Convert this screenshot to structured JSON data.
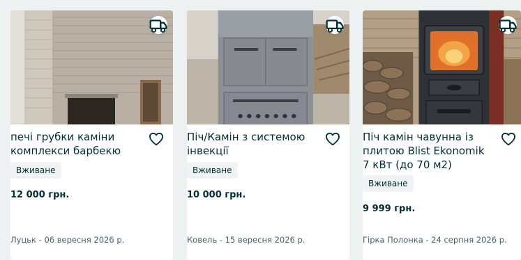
{
  "listings": [
    {
      "title": "печі грубки каміни комплекси барбекю",
      "condition": "Вживане",
      "price": "12 000 грн.",
      "location_date": "Луцьк - 06 вересня 2026 р.",
      "image_icon": "fireplace-photo",
      "delivery_icon": "delivery-truck-icon",
      "favorite_icon": "heart-outline-icon"
    },
    {
      "title": "Піч/Камін з системою інвекції",
      "condition": "Вживане",
      "price": "10 000 грн.",
      "location_date": "Ковель - 15 вересня 2026 р.",
      "image_icon": "stove-photo",
      "delivery_icon": "delivery-truck-icon",
      "favorite_icon": "heart-outline-icon"
    },
    {
      "title": "Піч камін чавунна із плитою Blist Ekonomik 7 кВт (до 70 м2)",
      "condition": "Вживане",
      "price": "9 999 грн.",
      "location_date": "Гірка Полонка - 24 серпня 2026 р.",
      "image_icon": "cast-iron-stove-photo",
      "delivery_icon": "delivery-truck-icon",
      "favorite_icon": "heart-outline-icon"
    }
  ],
  "colors": {
    "background": "#eef1f2",
    "card": "#ffffff",
    "text": "#002f34",
    "muted": "#406367",
    "badge_bg": "#eff3f3"
  }
}
